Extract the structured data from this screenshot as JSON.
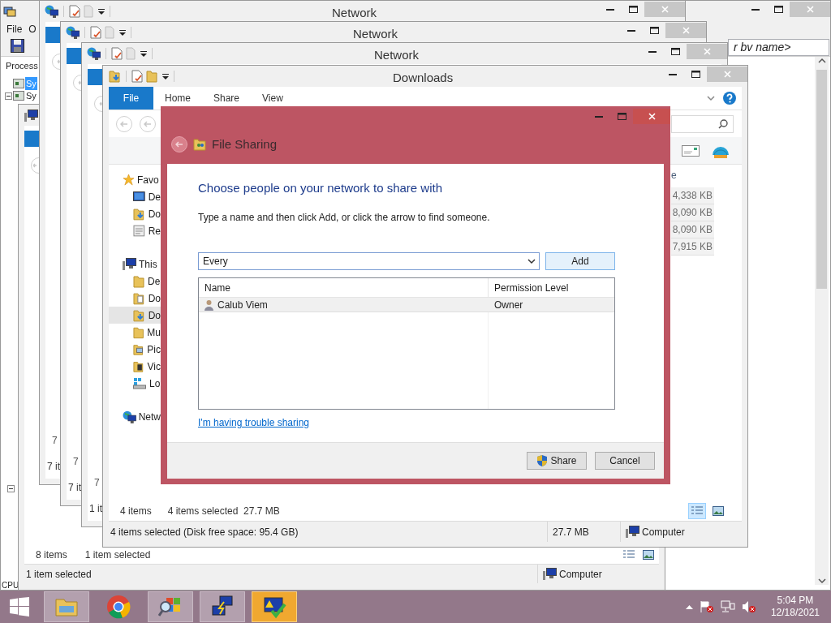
{
  "background_window": {
    "menu": [
      "File",
      "O"
    ],
    "tree_header": "Process",
    "tree_items": [
      {
        "label": "Sy",
        "selected": true
      },
      {
        "label": "Sy",
        "selected": false
      }
    ],
    "filter_field": {
      "value": "r bv name>"
    },
    "footer": "CPU"
  },
  "explorer_window": {
    "status_count": "8 items",
    "status_selection": "1 item selected",
    "status_bar": "1 item selected",
    "location": "Computer"
  },
  "network_windows": [
    {
      "title": "Network",
      "row_fragment": "7",
      "status_fragment": "7 it"
    },
    {
      "title": "Network",
      "row_fragment": "7",
      "status_fragment": "7 it"
    },
    {
      "title": "Network",
      "row_fragment": "7",
      "status_fragment": "1 it"
    }
  ],
  "downloads_window": {
    "title": "Downloads",
    "ribbon_tabs": [
      {
        "label": "File",
        "selected": true
      },
      {
        "label": "Home",
        "selected": false
      },
      {
        "label": "Share",
        "selected": false
      },
      {
        "label": "View",
        "selected": false
      }
    ],
    "nav": [
      {
        "label": "Favo",
        "kind": "star",
        "selected": false,
        "children": [
          {
            "label": "De",
            "kind": "desktop",
            "selected": false
          },
          {
            "label": "Do",
            "kind": "download",
            "selected": false
          },
          {
            "label": "Re",
            "kind": "recent",
            "selected": false
          }
        ]
      },
      {
        "label": "This",
        "kind": "computer",
        "selected": false,
        "children": [
          {
            "label": "De",
            "kind": "folder",
            "selected": false
          },
          {
            "label": "Do",
            "kind": "documents",
            "selected": false
          },
          {
            "label": "Do",
            "kind": "download",
            "selected": true
          },
          {
            "label": "Mu",
            "kind": "folder",
            "selected": false
          },
          {
            "label": "Pic",
            "kind": "pictures",
            "selected": false
          },
          {
            "label": "Vic",
            "kind": "videos",
            "selected": false
          },
          {
            "label": "Lo",
            "kind": "disk",
            "selected": false
          }
        ]
      },
      {
        "label": "Netw",
        "kind": "network",
        "selected": false
      }
    ],
    "size_header": "e",
    "sizes": [
      "4,338 KB",
      "8,090 KB",
      "8,090 KB",
      "7,915 KB"
    ],
    "status_count": "4 items",
    "status_selection": "4 items selected  27.7 MB",
    "views": [
      {
        "kind": "details",
        "selected": true
      },
      {
        "kind": "preview",
        "selected": false
      }
    ],
    "status_bar": {
      "text": "4 items selected (Disk free space: 95.4 GB)",
      "size": "27.7 MB",
      "location": "Computer"
    }
  },
  "dialog": {
    "title": "File Sharing",
    "heading": "Choose people on your network to share with",
    "instruction": "Type a name and then click Add, or click the arrow to find someone.",
    "name_field": {
      "value": "Every"
    },
    "add_button": "Add",
    "columns": [
      "Name",
      "Permission Level"
    ],
    "rows": [
      {
        "name": "Calub Viem",
        "permission": "Owner",
        "selected": true
      }
    ],
    "help_link": "I'm having trouble sharing",
    "buttons": [
      {
        "label": "Share",
        "kind": "shield"
      },
      {
        "label": "Cancel",
        "kind": "plain"
      }
    ]
  },
  "taskbar": {
    "apps": [
      {
        "kind": "folder",
        "running": true,
        "selected": false
      },
      {
        "kind": "browser",
        "running": false,
        "selected": false
      },
      {
        "kind": "magnifier",
        "running": true,
        "selected": false
      },
      {
        "kind": "computers",
        "running": true,
        "selected": false
      },
      {
        "kind": "checkmark",
        "running": true,
        "selected": true
      }
    ],
    "clock": {
      "time": "5:04 PM",
      "date": "12/18/2021"
    }
  }
}
